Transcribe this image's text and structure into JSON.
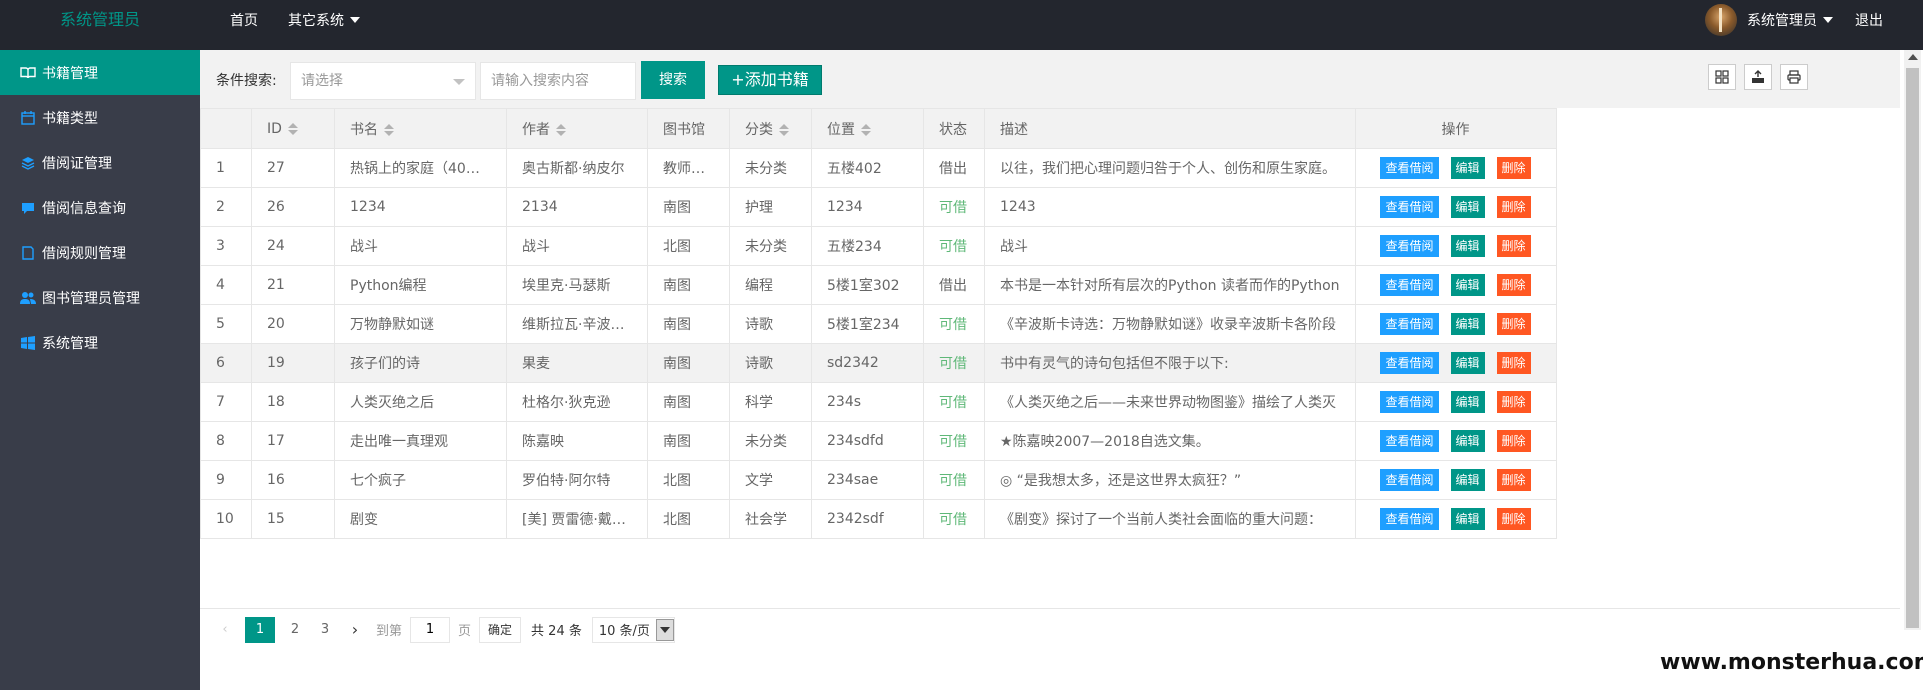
{
  "app": {
    "title": "系统管理员"
  },
  "topnav": [
    {
      "label": "首页",
      "dropdown": false
    },
    {
      "label": "其它系统",
      "dropdown": true
    }
  ],
  "user": {
    "name": "系统管理员",
    "logout": "退出"
  },
  "sidebar": {
    "items": [
      {
        "label": "书籍管理",
        "icon": "book-icon",
        "active": true
      },
      {
        "label": "书籍类型",
        "icon": "calendar-icon",
        "active": false
      },
      {
        "label": "借阅证管理",
        "icon": "layers-icon",
        "active": false
      },
      {
        "label": "借阅信息查询",
        "icon": "chat-icon",
        "active": false
      },
      {
        "label": "借阅规则管理",
        "icon": "note-icon",
        "active": false
      },
      {
        "label": "图书管理员管理",
        "icon": "users-icon",
        "active": false
      },
      {
        "label": "系统管理",
        "icon": "windows-icon",
        "active": false
      }
    ]
  },
  "toolbar": {
    "label": "条件搜索:",
    "select_placeholder": "请选择",
    "search_placeholder": "请输入搜索内容",
    "search_button": "搜索",
    "add_button": "+添加书籍"
  },
  "table": {
    "headers": [
      "",
      "ID",
      "书名",
      "作者",
      "图书馆",
      "分类",
      "位置",
      "状态",
      "描述",
      "操作"
    ],
    "actions": {
      "view": "查看借阅",
      "edit": "编辑",
      "del": "删除"
    },
    "rows": [
      {
        "no": "1",
        "id": "27",
        "name": "热锅上的家庭（40…",
        "author": "奥古斯都·纳皮尔",
        "lib": "教师…",
        "cat": "未分类",
        "loc": "五楼402",
        "status": "借出",
        "available": false,
        "desc": "以往，我们把心理问题归咎于个人、创伤和原生家庭。"
      },
      {
        "no": "2",
        "id": "26",
        "name": "1234",
        "author": "2134",
        "lib": "南图",
        "cat": "护理",
        "loc": "1234",
        "status": "可借",
        "available": true,
        "desc": "1243"
      },
      {
        "no": "3",
        "id": "24",
        "name": "战斗",
        "author": "战斗",
        "lib": "北图",
        "cat": "未分类",
        "loc": "五楼234",
        "status": "可借",
        "available": true,
        "desc": "战斗"
      },
      {
        "no": "4",
        "id": "21",
        "name": "Python编程",
        "author": "埃里克·马瑟斯",
        "lib": "南图",
        "cat": "编程",
        "loc": "5楼1室302",
        "status": "借出",
        "available": false,
        "desc": "本书是一本针对所有层次的Python 读者而作的Python"
      },
      {
        "no": "5",
        "id": "20",
        "name": "万物静默如谜",
        "author": "维斯拉瓦·辛波…",
        "lib": "南图",
        "cat": "诗歌",
        "loc": "5楼1室234",
        "status": "可借",
        "available": true,
        "desc": "《辛波斯卡诗选：万物静默如谜》收录辛波斯卡各阶段"
      },
      {
        "no": "6",
        "id": "19",
        "name": "孩子们的诗",
        "author": "果麦",
        "lib": "南图",
        "cat": "诗歌",
        "loc": "sd2342",
        "status": "可借",
        "available": true,
        "desc": "书中有灵气的诗句包括但不限于以下:"
      },
      {
        "no": "7",
        "id": "18",
        "name": "人类灭绝之后",
        "author": "杜格尔·狄克逊",
        "lib": "南图",
        "cat": "科学",
        "loc": "234s",
        "status": "可借",
        "available": true,
        "desc": "《人类灭绝之后——未来世界动物图鉴》描绘了人类灭"
      },
      {
        "no": "8",
        "id": "17",
        "name": "走出唯一真理观",
        "author": "陈嘉映",
        "lib": "南图",
        "cat": "未分类",
        "loc": "234sdfd",
        "status": "可借",
        "available": true,
        "desc": "★陈嘉映2007—2018自选文集。"
      },
      {
        "no": "9",
        "id": "16",
        "name": "七个疯子",
        "author": "罗伯特·阿尔特",
        "lib": "北图",
        "cat": "文学",
        "loc": "234sae",
        "status": "可借",
        "available": true,
        "desc": "◎ “是我想太多，还是这世界太疯狂？”"
      },
      {
        "no": "10",
        "id": "15",
        "name": "剧变",
        "author": "[美] 贾雷德·戴…",
        "lib": "北图",
        "cat": "社会学",
        "loc": "2342sdf",
        "status": "可借",
        "available": true,
        "desc": "《剧变》探讨了一个当前人类社会面临的重大问题："
      }
    ]
  },
  "pager": {
    "pages": [
      "1",
      "2",
      "3"
    ],
    "current": "1",
    "goto_label": "到第",
    "goto_value": "1",
    "page_unit": "页",
    "confirm": "确定",
    "total": "共 24 条",
    "limit": "10 条/页"
  },
  "watermark": "www.monsterhua.com",
  "colors": {
    "header": "#23262e",
    "sidebar": "#393d49",
    "accent": "#009688",
    "blue": "#1e9fff",
    "red": "#ff5722",
    "green_text": "#5fb878"
  }
}
